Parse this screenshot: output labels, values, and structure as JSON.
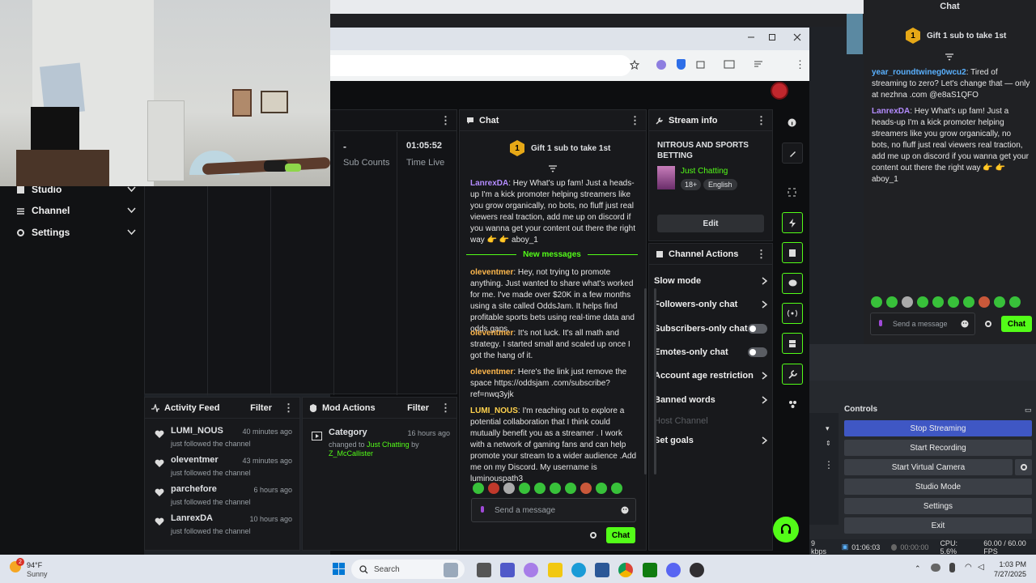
{
  "browser": {
    "title_bar_buttons": [
      "minimize",
      "maximize",
      "close"
    ]
  },
  "nav": [
    {
      "label": "Studio",
      "icon": "studio-icon"
    },
    {
      "label": "Channel",
      "icon": "channel-icon"
    },
    {
      "label": "Settings",
      "icon": "gear-icon"
    }
  ],
  "stats": {
    "sub_counts_value": "-",
    "sub_counts_label": "Sub Counts",
    "time_live_value": "01:05:52",
    "time_live_label": "Time Live"
  },
  "chat": {
    "title": "Chat",
    "gift_text": "Gift 1 sub to take 1st",
    "gift_badge": "1",
    "messages_before": [
      {
        "user": "LanrexDA",
        "text": ": Hey What's up fam! Just a heads-up I'm a kick promoter helping streamers like you grow organically, no bots, no fluff just real viewers real traction, add me up on discord if you wanna get your content out there the right way 👉 👉 aboy_1"
      }
    ],
    "new_messages_label": "New messages",
    "messages_after": [
      {
        "user": "oleventmer",
        "text": ": Hey, not trying to promote anything. Just wanted to share what's worked for me. I've made over $20K in a few months using a site called OddsJam. It helps find profitable sports bets using real-time data and odds gaps."
      },
      {
        "user": "oleventmer",
        "text": ": It's not luck. It's all math and strategy. I started small and scaled up once I got the hang of it."
      },
      {
        "user": "oleventmer",
        "text": ": Here's the link just remove the space https://oddsjam .com/subscribe?ref=nwq3yjk"
      },
      {
        "user": "LUMI_NOUS",
        "text": ": I'm reaching out to explore a potential collaboration that I think could mutually benefit you as a streamer . I work with a network of gaming fans and can help promote your stream to a wider audience .Add me on my Discord. My username is luminouspath3"
      }
    ],
    "input_placeholder": "Send a message",
    "send_label": "Chat"
  },
  "stream_info": {
    "title": "Stream info",
    "stream_title": "NITROUS AND SPORTS BETTING",
    "category": "Just Chatting",
    "tags": [
      "18+",
      "English"
    ],
    "edit_label": "Edit"
  },
  "channel_actions": {
    "title": "Channel Actions",
    "items": [
      {
        "label": "Slow mode",
        "control": "chevron"
      },
      {
        "label": "Followers-only chat",
        "control": "chevron"
      },
      {
        "label": "Subscribers-only chat",
        "control": "toggle"
      },
      {
        "label": "Emotes-only chat",
        "control": "toggle"
      },
      {
        "label": "Account age restriction",
        "control": "chevron"
      },
      {
        "label": "Banned words",
        "control": "chevron"
      },
      {
        "label": "Host Channel",
        "control": "none"
      },
      {
        "label": "Set goals",
        "control": "chevron"
      }
    ]
  },
  "activity_feed": {
    "title": "Activity Feed",
    "filter_label": "Filter",
    "items": [
      {
        "user": "LUMI_NOUS",
        "time": "40 minutes ago",
        "action": "just followed the channel"
      },
      {
        "user": "oleventmer",
        "time": "43 minutes ago",
        "action": "just followed the channel"
      },
      {
        "user": "parchefore",
        "time": "6 hours ago",
        "action": "just followed the channel"
      },
      {
        "user": "LanrexDA",
        "time": "10 hours ago",
        "action": "just followed the channel"
      }
    ]
  },
  "mod_actions": {
    "title": "Mod Actions",
    "filter_label": "Filter",
    "items": [
      {
        "title": "Category",
        "time": "16 hours ago",
        "prefix": "changed to ",
        "category": "Just Chatting",
        "by": " by ",
        "user": "Z_McCallister"
      }
    ]
  },
  "right_chat": {
    "title": "Chat",
    "gift_text": "Gift 1 sub to take 1st",
    "gift_badge": "1",
    "messages": [
      {
        "user": "year_roundtwineg0wcu2",
        "text": ": Tired of streaming to zero? Let's change that — only at nezhna .com @e8aS1QFO"
      },
      {
        "user": "LanrexDA",
        "text": ": Hey What's up fam! Just a heads-up I'm a kick promoter helping streamers like you grow organically, no bots, no fluff just real viewers real traction, add me up on discord if you wanna get your content out there the right way 👉 👉 aboy_1"
      }
    ],
    "input_placeholder": "Send a message",
    "send_label": "Chat"
  },
  "obs": {
    "controls_title": "Controls",
    "buttons": [
      "Stop Streaming",
      "Start Recording",
      "Start Virtual Camera",
      "Studio Mode",
      "Settings",
      "Exit"
    ],
    "status": {
      "kbps": "9 kbps",
      "live_time": "01:06:03",
      "rec_time": "00:00:00",
      "cpu": "CPU: 5.6%",
      "fps": "60.00 / 60.00 FPS"
    }
  },
  "taskbar": {
    "weather_temp": "94°F",
    "weather_desc": "Sunny",
    "weather_badge": "2",
    "search_placeholder": "Search",
    "time": "1:03 PM",
    "date": "7/27/2025"
  },
  "colors": {
    "accent": "#53fc18",
    "panel": "#18191c",
    "background": "#0d0e10"
  }
}
